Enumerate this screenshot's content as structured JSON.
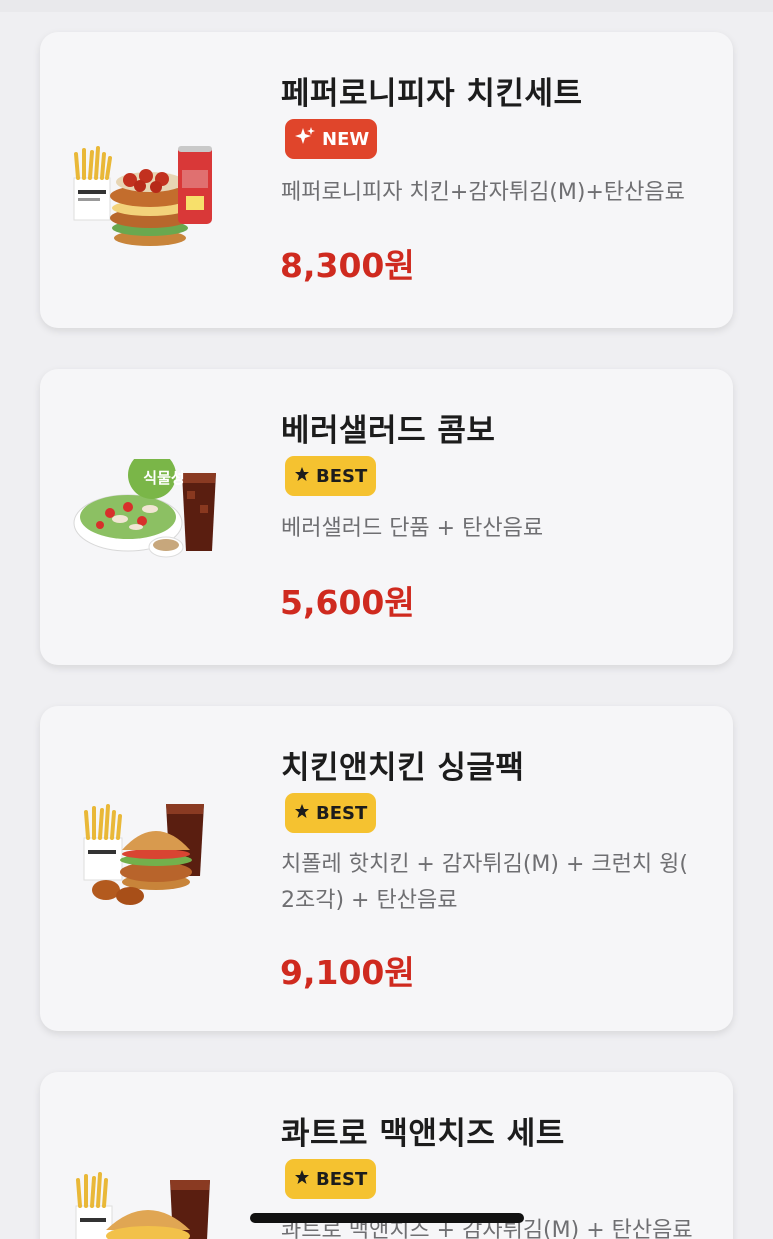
{
  "menu_items": [
    {
      "name": "페퍼로니피자 치킨세트",
      "badge": "NEW",
      "badge_icon": "sparkle-icon",
      "description": "페퍼로니피자 치킨+감자튀김(M)+탄산음료",
      "price": "8,300원",
      "image": "pepperoni-pizza-chicken-set-image"
    },
    {
      "name": "베러샐러드 콤보",
      "badge": "BEST",
      "badge_icon": "star-icon",
      "image_tag": "식물성",
      "description": "베러샐러드 단품 + 탄산음료",
      "price": "5,600원",
      "image": "better-salad-combo-image"
    },
    {
      "name": "치킨앤치킨 싱글팩",
      "badge": "BEST",
      "badge_icon": "star-icon",
      "description": "치폴레 핫치킨 + 감자튀김(M) + 크런치 윙( 2조각) + 탄산음료",
      "price": "9,100원",
      "image": "chicken-and-chicken-single-pack-image"
    },
    {
      "name": "콰트로 맥앤치즈 세트",
      "badge": "BEST",
      "badge_icon": "star-icon",
      "description": "콰트로 맥앤치즈 + 감자튀김(M) + 탄산음료",
      "price": "",
      "image": "quattro-mac-and-cheese-set-image"
    }
  ],
  "colors": {
    "new_badge": "#e0452b",
    "best_badge": "#f5c230",
    "price": "#cf2a1f",
    "card_bg": "#f6f6f8",
    "page_bg": "#efeff2"
  }
}
